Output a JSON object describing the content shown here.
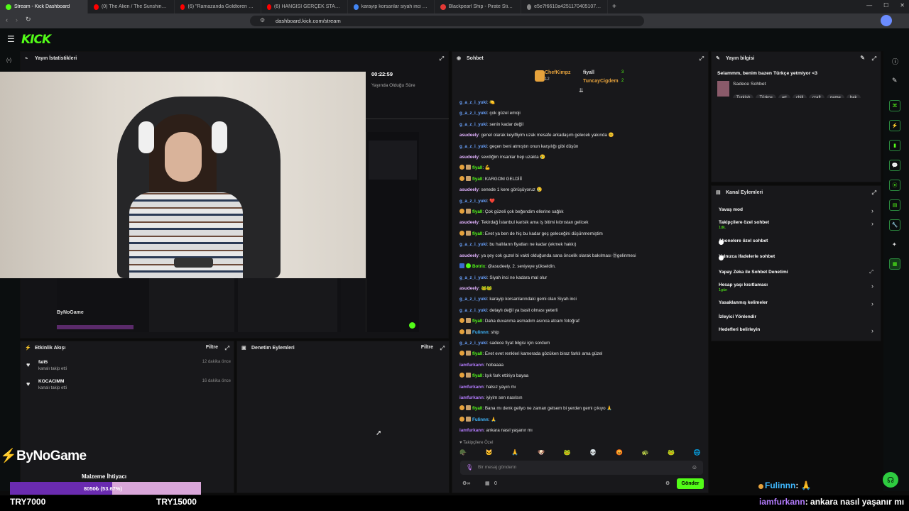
{
  "browser": {
    "tabs": [
      {
        "label": "Stream - Kick Dashboard",
        "color": "#53fc18",
        "active": true
      },
      {
        "label": "(0) The Alien / The Sunshine / Th...",
        "color": "#ff0000"
      },
      {
        "label": "(6) \"Ramazanda Goldtoren Edis\" Kick",
        "color": "#ff0000"
      },
      {
        "label": "(6) HANGİSİ GERÇEK STAND-UP KOİ...",
        "color": "#ff0000"
      },
      {
        "label": "karayip korsanlar siyah inci - Google",
        "color": "#4285f4"
      },
      {
        "label": "Blackpearl Ship - Pirate Sticker",
        "color": "#e53935"
      },
      {
        "label": "e5e7f6610a42511704051073e3a7a5?...",
        "color": "#888"
      }
    ],
    "url": "dashboard.kick.com/stream"
  },
  "kick": {
    "logo": "KICK"
  },
  "stats": {
    "title": "Yayın İstatistikleri",
    "time": "00:22:59",
    "time_label": "Yayında Olduğu Süre"
  },
  "activity": {
    "title": "Etkinlik Akışı",
    "filter": "Filtre",
    "items": [
      {
        "name": "fali5",
        "action": "kanalı takip etti",
        "time": "12 dakika önce"
      },
      {
        "name": "KOCACIMM",
        "action": "kanalı takip etti",
        "time": "16 dakika önce"
      }
    ]
  },
  "moderation": {
    "title": "Denetim Eylemleri",
    "filter": "Filtre"
  },
  "chat": {
    "title": "Sohbet",
    "top": [
      {
        "name": "ChefKimpz",
        "count": "12"
      },
      {
        "name": "fiyall",
        "count": "3"
      },
      {
        "name": "TuncayCigdem",
        "count": "2"
      }
    ],
    "messages": [
      {
        "user": "g_a_z_i_yuki",
        "cls": "u1",
        "badge": "",
        "text": ": 🍋"
      },
      {
        "user": "g_a_z_i_yuki",
        "cls": "u1",
        "badge": "",
        "text": ": çok güzel emoji"
      },
      {
        "user": "g_a_z_i_yuki",
        "cls": "u1",
        "badge": "",
        "text": ": senin kadar değil"
      },
      {
        "user": "asudeely",
        "cls": "u2",
        "badge": "",
        "text": ": genel olarak keyifliyim uzak mesafe arkadaşım gelecek yakında 😊"
      },
      {
        "user": "g_a_z_i_yuki",
        "cls": "u1",
        "badge": "",
        "text": ": geçen beni atmıştın onun karşılığı gibi düşün"
      },
      {
        "user": "asudeely",
        "cls": "u2",
        "badge": "",
        "text": ": sevdiğim insanlar hep uzakta 🥲"
      },
      {
        "user": "fiyall",
        "cls": "u3",
        "badge": "b",
        "text": ": 💪"
      },
      {
        "user": "fiyall",
        "cls": "u3",
        "badge": "b",
        "text": ": KARGOM GELDİİİ"
      },
      {
        "user": "asudeely",
        "cls": "u2",
        "badge": "",
        "text": ": senede 1 kere görüşüyoruz 🥲"
      },
      {
        "user": "g_a_z_i_yuki",
        "cls": "u1",
        "badge": "",
        "text": ": ❤️"
      },
      {
        "user": "fiyall",
        "cls": "u3",
        "badge": "b",
        "text": ": Çok güzeli çok beğendim ellerine sağlık"
      },
      {
        "user": "asudeely",
        "cls": "u2",
        "badge": "",
        "text": ": Tekirdağ İstanbul karisik ama iş bitimi kıbrıstan gelicek"
      },
      {
        "user": "fiyall",
        "cls": "u3",
        "badge": "b",
        "text": ": Evet ya ben de hiç bu kadar geç geleceğini düşünmemiştim"
      },
      {
        "user": "g_a_z_i_yuki",
        "cls": "u1",
        "badge": "",
        "text": ": bu hallıların fiyatları ne kadar (ekmek hakkı)"
      },
      {
        "user": "asudeely",
        "cls": "u2",
        "badge": "",
        "text": ": ya şey cok guzel bi vakti olduğunda sana öncelik olarak bakılması Ⓓgelinmesi"
      },
      {
        "user": "Botrix",
        "cls": "u3",
        "badge": "bot",
        "text": ": @asudeely, 2. seviyeye yükseldin."
      },
      {
        "user": "g_a_z_i_yuki",
        "cls": "u1",
        "badge": "",
        "text": ": Siyah inci ne kadara mal olur"
      },
      {
        "user": "asudeely",
        "cls": "u2",
        "badge": "",
        "text": ": 🐸🐸"
      },
      {
        "user": "g_a_z_i_yuki",
        "cls": "u1",
        "badge": "",
        "text": ": karayip korsanlarındaki gemi olan Siyah inci"
      },
      {
        "user": "g_a_z_i_yuki",
        "cls": "u1",
        "badge": "",
        "text": ": detaylı değil ya basit olması yeterli"
      },
      {
        "user": "fiyall",
        "cls": "u3",
        "badge": "b",
        "text": ": Daha duvarıma asmadım asınca atcam fotoğraf"
      },
      {
        "user": "Fulinnn",
        "cls": "u5",
        "badge": "b",
        "text": ": ship"
      },
      {
        "user": "g_a_z_i_yuki",
        "cls": "u1",
        "badge": "",
        "text": ": sadece fiyat bilgisi için sordum"
      },
      {
        "user": "fiyall",
        "cls": "u3",
        "badge": "b",
        "text": ": Evet evet renkleri kamerada gözüken biraz farklı ama güzel"
      },
      {
        "user": "iamfurkann",
        "cls": "u4",
        "badge": "",
        "text": ": hobaaaa"
      },
      {
        "user": "fiyall",
        "cls": "u3",
        "badge": "b",
        "text": ": Işık fark ettiriyo bayaa"
      },
      {
        "user": "iamfurkann",
        "cls": "u4",
        "badge": "",
        "text": ": halsız yayın mı"
      },
      {
        "user": "iamfurkann",
        "cls": "u4",
        "badge": "",
        "text": ": iyiyim sen nasılsın"
      },
      {
        "user": "fiyall",
        "cls": "u3",
        "badge": "b",
        "text": ": Bana mı denk geliyo ne zaman gelsem bi yerden gemi çıkıyo 🙏"
      },
      {
        "user": "Fulinnn",
        "cls": "u5",
        "badge": "b",
        "text": ": 🙏"
      },
      {
        "user": "iamfurkann",
        "cls": "u4",
        "badge": "",
        "text": ": ankara nasıl yaşanır mı"
      }
    ],
    "followers_only": "Takipçilere Özel",
    "input_placeholder": "Bir mesaj gönderin",
    "send": "Gönder",
    "viewers": "0"
  },
  "stream_info": {
    "title": "Yayın bilgisi",
    "stream_title": "Selammm, benim bazen Türkçe yetmiyor <3",
    "category": "Sadece Sohbet",
    "tags": [
      "Turkish",
      "Türkçe",
      "art",
      "chill",
      "craft",
      "game",
      "hak"
    ]
  },
  "channel_actions": {
    "title": "Kanal Eylemleri",
    "items": [
      {
        "label": "Yavaş mod",
        "sub": "",
        "ctl": "chev"
      },
      {
        "label": "Takipçilere özel sohbet",
        "sub": "1dk.",
        "ctl": "chev"
      },
      {
        "label": "Abonelere özel sohbet",
        "sub": "",
        "ctl": "toggle"
      },
      {
        "label": "Yalnızca ifadelerle sohbet",
        "sub": "",
        "ctl": "toggle"
      },
      {
        "label": "Yapay Zeka ile Sohbet Denetimi",
        "sub": "",
        "ctl": "ext"
      },
      {
        "label": "Hesap yaşı kısıtlaması",
        "sub": "1gün",
        "ctl": "chev"
      },
      {
        "label": "Yasaklanmış kelimeler",
        "sub": "",
        "ctl": "chev"
      },
      {
        "label": "İzleyici Yönlendir",
        "sub": "",
        "ctl": ""
      },
      {
        "label": "Hedefleri belirleyin",
        "sub": "",
        "ctl": "chev"
      }
    ]
  },
  "overlay": {
    "brand": "ByNoGame",
    "goal_title": "Malzeme İhtiyacı",
    "goal_text": "8050₺ (53.67%)",
    "goal_fraction": 0.5367,
    "left_amount": "TRY7000",
    "right_amount": "TRY15000",
    "ticker_user1": "Fulinnn",
    "ticker_text1": ": 🙏",
    "ticker_user2": "iamfurkann",
    "ticker_text2": ": ankara nasıl yaşanır mı"
  }
}
